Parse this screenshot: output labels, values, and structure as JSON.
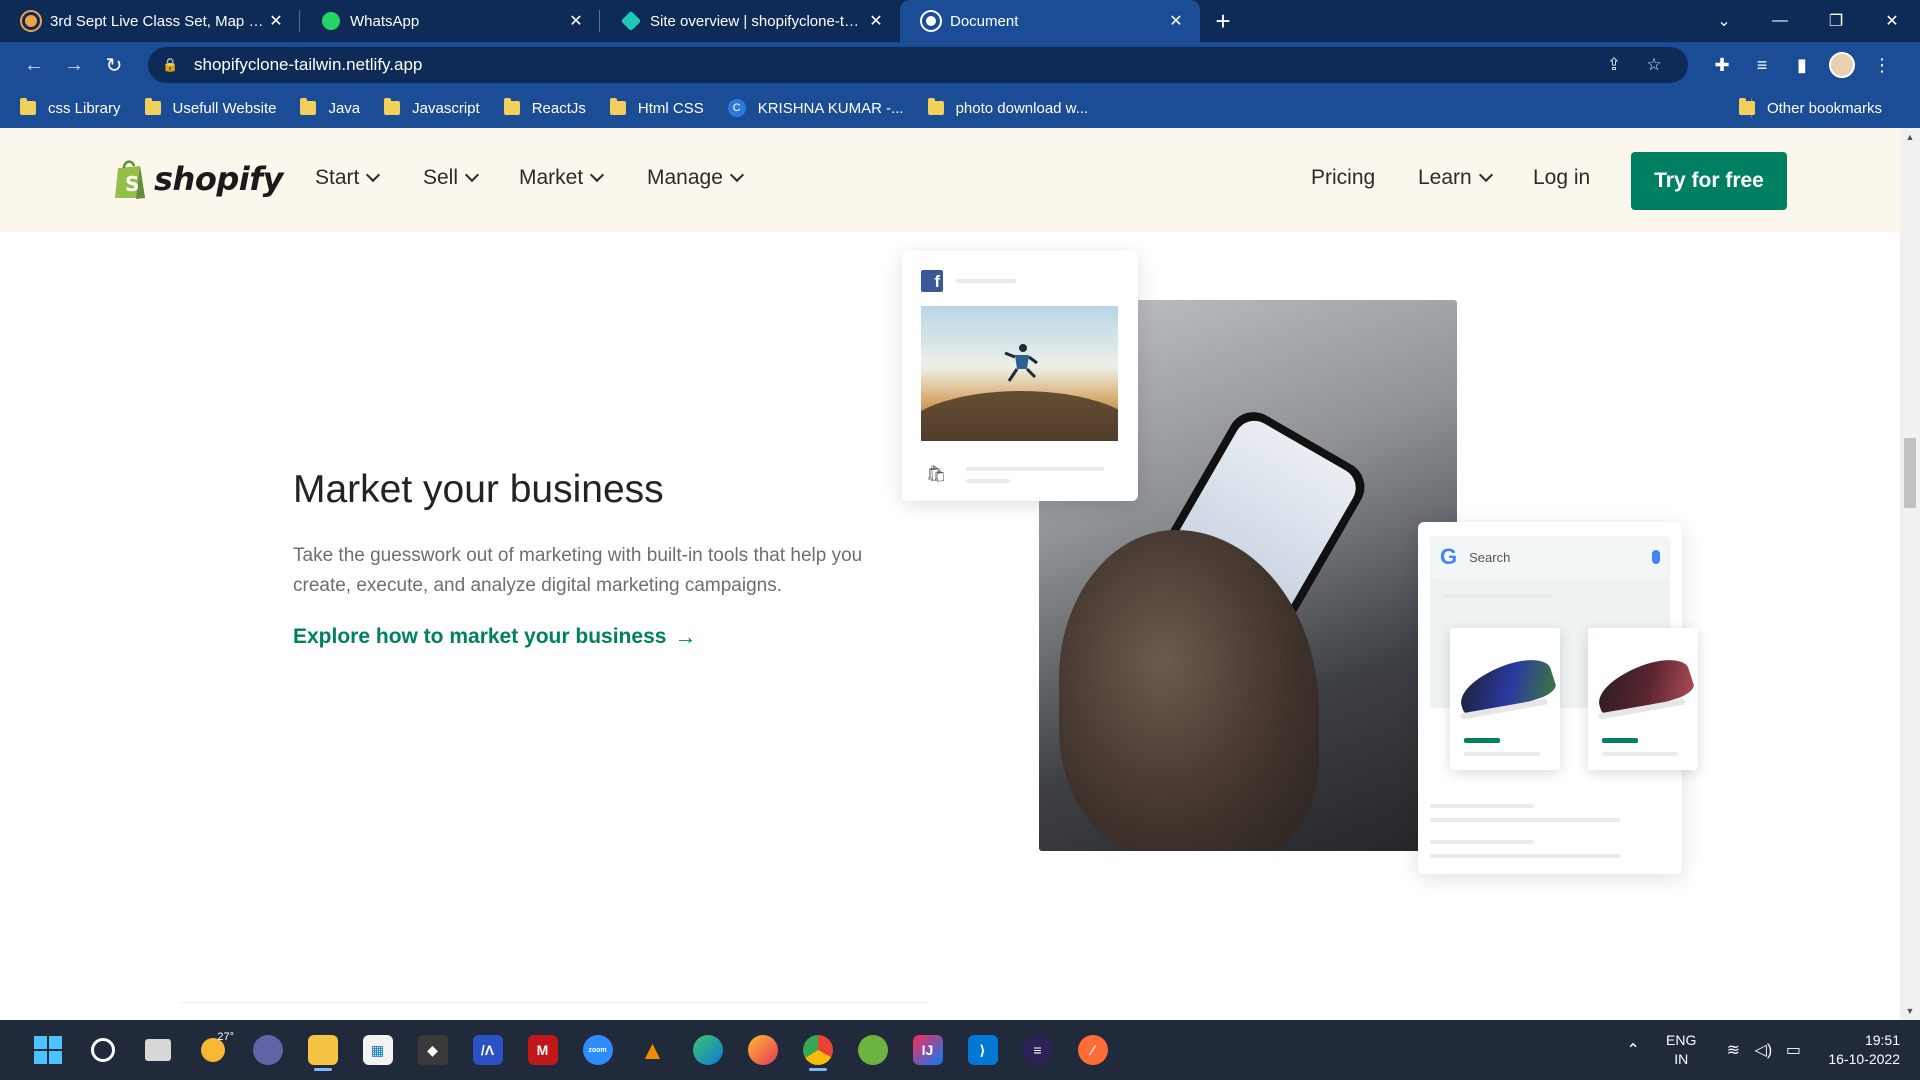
{
  "browser": {
    "tabs": [
      {
        "title": "3rd Sept Live Class Set, Map , Clo",
        "favicon_color": "#f0a24a",
        "active": false
      },
      {
        "title": "WhatsApp",
        "favicon_color": "#25d366",
        "active": false
      },
      {
        "title": "Site overview | shopifyclone-tailw",
        "favicon_color": "#20c6b6",
        "active": false
      },
      {
        "title": "Document",
        "favicon_color": "#ffffff",
        "active": true
      }
    ],
    "url": "shopifyclone-tailwin.netlify.app",
    "bookmarks": [
      {
        "label": "css Library",
        "icon": "folder-icon"
      },
      {
        "label": "Usefull Website",
        "icon": "folder-icon"
      },
      {
        "label": "Java",
        "icon": "folder-icon"
      },
      {
        "label": "Javascript",
        "icon": "folder-icon"
      },
      {
        "label": "ReactJs",
        "icon": "folder-icon"
      },
      {
        "label": "Html CSS",
        "icon": "folder-icon"
      },
      {
        "label": "KRISHNA KUMAR -...",
        "icon": "site-icon"
      },
      {
        "label": "photo download w...",
        "icon": "folder-icon"
      }
    ],
    "other_bookmarks": "Other bookmarks"
  },
  "site": {
    "logo": "shopify",
    "nav": {
      "start": "Start",
      "sell": "Sell",
      "market": "Market",
      "manage": "Manage",
      "pricing": "Pricing",
      "learn": "Learn",
      "login": "Log in"
    },
    "cta": "Try for free",
    "hero": {
      "title": "Market your business",
      "description": "Take the guesswork out of marketing with built-in tools that help you create, execute, and analyze digital marketing campaigns.",
      "link": "Explore how to market your business",
      "link_arrow": "→"
    },
    "illustration": {
      "search_placeholder": "Search",
      "fb_icon": "f",
      "google_icon": "G"
    },
    "brand_color": "#008060",
    "header_bg": "#fbf7ed"
  },
  "taskbar": {
    "weather_temp": "27°",
    "language": "ENG",
    "region": "IN",
    "time": "19:51",
    "date": "16-10-2022"
  }
}
